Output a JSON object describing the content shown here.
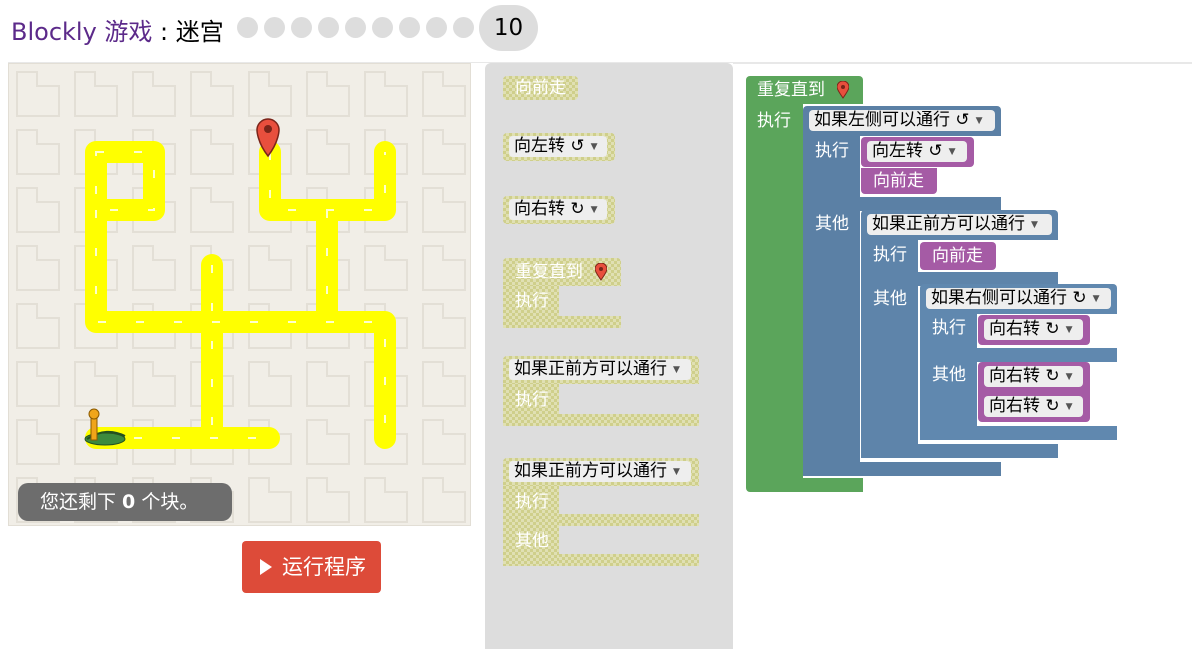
{
  "header": {
    "app_name": "Blockly 游戏",
    "separator": " : ",
    "game_name": "迷宫",
    "level_dots": 9,
    "current_level": "10"
  },
  "maze": {
    "capacity_prefix": "您还剩下 ",
    "capacity_count": "0",
    "capacity_suffix": " 个块。",
    "run_label": "运行程序"
  },
  "toolbox": {
    "move_forward": "向前走",
    "turn_left": "向左转 ↺",
    "turn_right": "向右转 ↻",
    "repeat_until": "重复直到",
    "do_label": "执行",
    "if_path_ahead": "如果正前方可以通行",
    "else_label": "其他"
  },
  "workspace": {
    "repeat_until": "重复直到",
    "do_label": "执行",
    "else_label": "其他",
    "if_left": "如果左侧可以通行 ↺",
    "if_ahead": "如果正前方可以通行",
    "if_right": "如果右侧可以通行 ↻",
    "turn_left": "向左转 ↺",
    "move_forward": "向前走",
    "turn_right": "向右转 ↻"
  },
  "colors": {
    "loop_block": "#5ba55b",
    "logic_block": "#5b80a5",
    "movement_block": "#a55ba5",
    "run_button": "#dd4b39",
    "maze_path": "#ffff00",
    "toolbox_bg": "#dddddd",
    "title": "#5c2a8a"
  }
}
